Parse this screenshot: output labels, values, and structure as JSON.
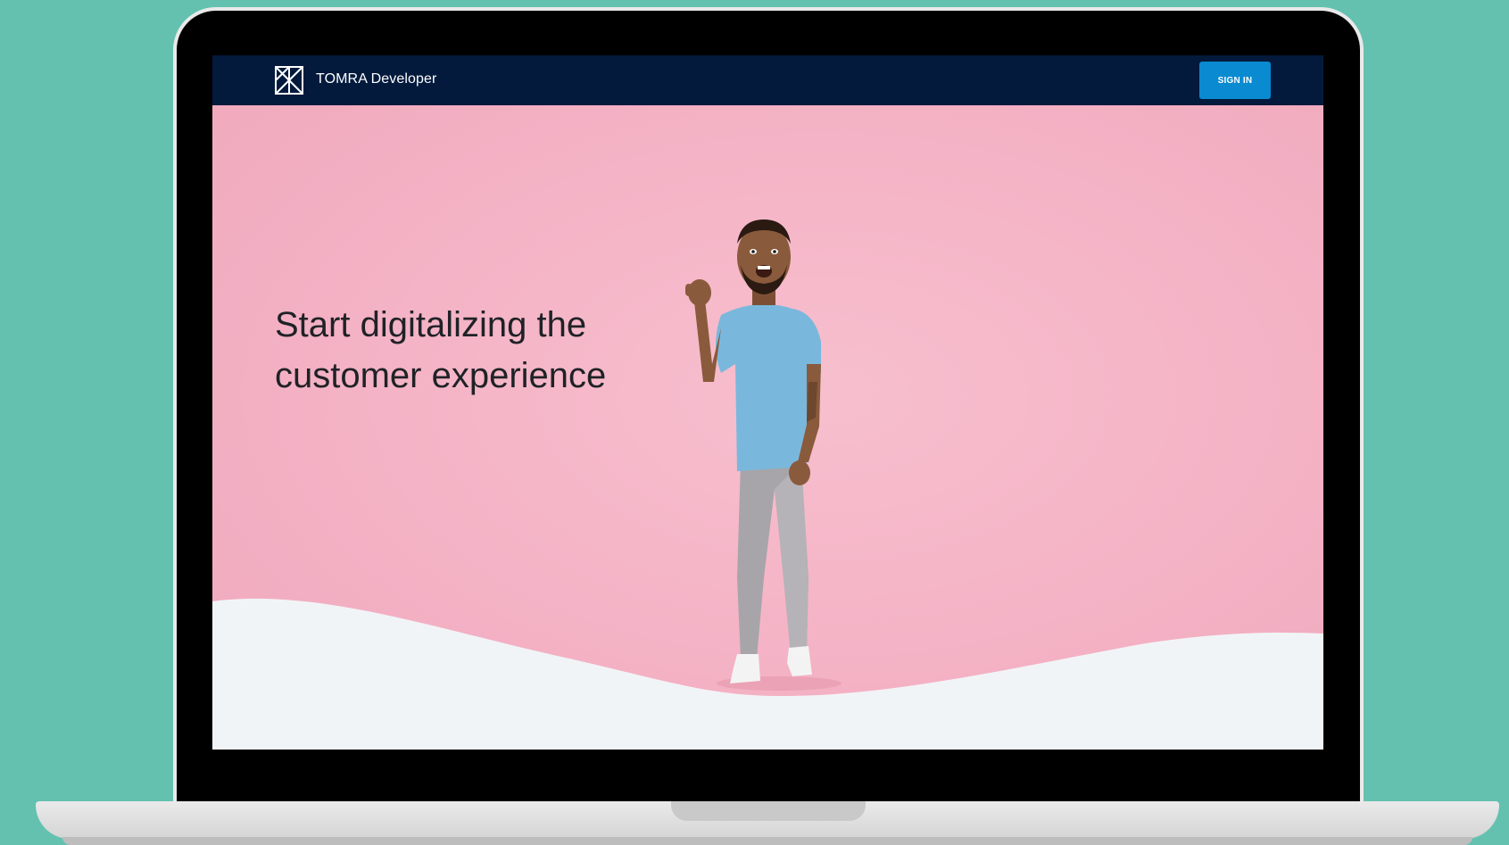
{
  "navbar": {
    "brand": "TOMRA Developer",
    "logo_icon": "tomra-logo-icon",
    "signin_label": "SIGN IN"
  },
  "hero": {
    "headline": "Start digitalizing the customer experience",
    "image": "smiling-man-pointing-photo"
  },
  "colors": {
    "background": "#64c1b0",
    "navbar": "#031a3d",
    "button": "#0a8ad0",
    "hero_pink": "#f4b2c5",
    "wave": "#f1f4f6"
  }
}
